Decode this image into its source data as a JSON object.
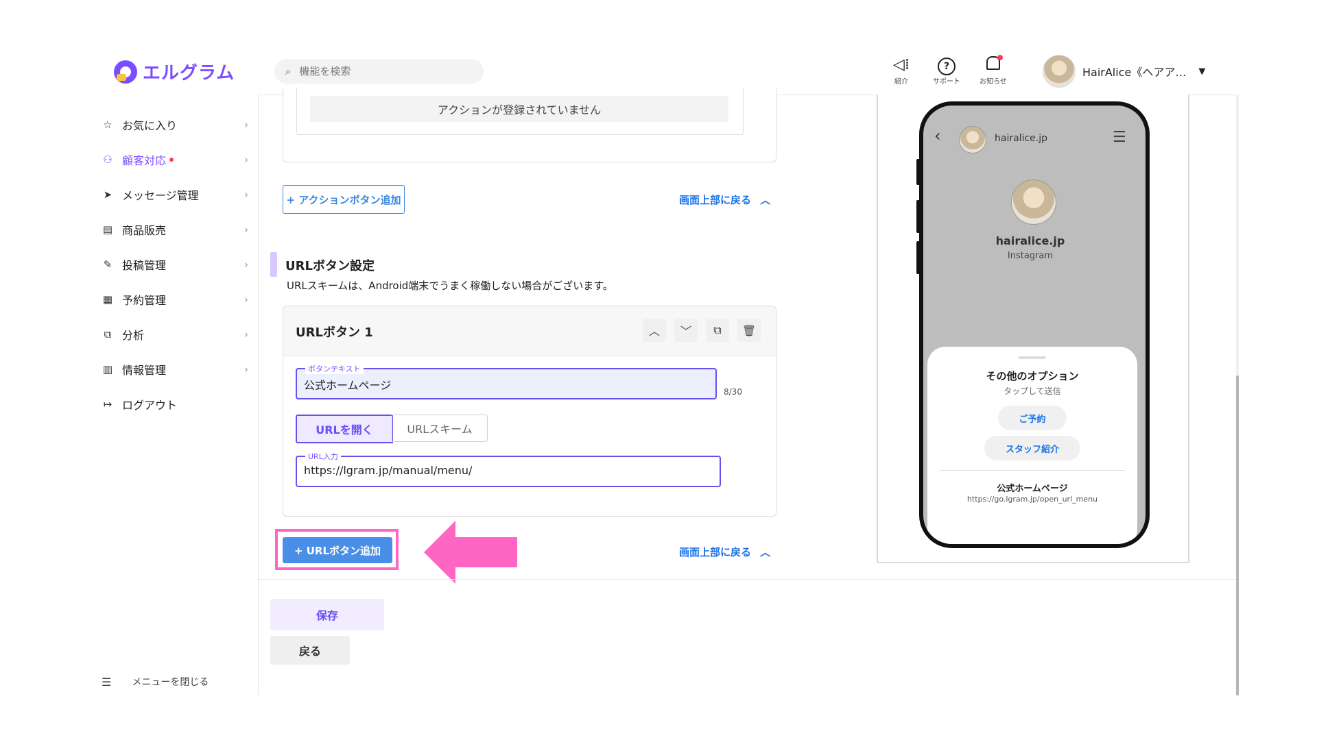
{
  "logo": {
    "text": "エルグラム"
  },
  "search": {
    "placeholder": "機能を検索"
  },
  "header_icons": [
    {
      "label": "紹介",
      "glyph": "📢"
    },
    {
      "label": "サポート",
      "glyph": "?"
    },
    {
      "label": "お知らせ",
      "glyph": "🔔"
    }
  ],
  "user": {
    "name": "HairAlice《ヘアア…"
  },
  "sidebar": {
    "items": [
      {
        "label": "お気に入り",
        "icon": "☆",
        "active": false
      },
      {
        "label": "顧客対応",
        "icon": "⚇",
        "active": true,
        "dot": true
      },
      {
        "label": "メッセージ管理",
        "icon": "➤",
        "active": false
      },
      {
        "label": "商品販売",
        "icon": "▤",
        "active": false
      },
      {
        "label": "投稿管理",
        "icon": "✎",
        "active": false
      },
      {
        "label": "予約管理",
        "icon": "▦",
        "active": false
      },
      {
        "label": "分析",
        "icon": "⧉",
        "active": false
      },
      {
        "label": "情報管理",
        "icon": "▥",
        "active": false
      },
      {
        "label": "ログアウト",
        "icon": "↦",
        "active": false
      }
    ],
    "close_label": "メニューを閉じる"
  },
  "actions": {
    "empty_text": "アクションが登録されていません",
    "add_button": "+ アクションボタン追加",
    "back_to_top": "画面上部に戻る"
  },
  "url_section": {
    "title": "URLボタン設定",
    "description": "URLスキームは、Android端末でうまく稼働しない場合がございます。",
    "card_title": "URLボタン 1",
    "text_label": "ボタンテキスト",
    "text_value": "公式ホームページ",
    "counter": "8/30",
    "seg_open": "URLを開く",
    "seg_scheme": "URLスキーム",
    "url_label": "URL入力",
    "url_value": "https://lgram.jp/manual/menu/",
    "add_button": "+ URLボタン追加",
    "back_to_top": "画面上部に戻る"
  },
  "footer": {
    "save": "保存",
    "back": "戻る"
  },
  "phone": {
    "header_handle": "hairalice.jp",
    "profile_name": "hairalice.jp",
    "profile_sub": "Instagram",
    "sheet_title": "その他のオプション",
    "sheet_sub": "タップして送信",
    "pills": [
      "ご予約",
      "スタッフ紹介"
    ],
    "link_title": "公式ホームページ",
    "link_url": "https://go.lgram.jp/open_url_menu"
  },
  "colors": {
    "brand": "#7c4dff",
    "link": "#1a73e8",
    "highlight": "#ff66c4",
    "primary_button": "#4a8fe7"
  }
}
